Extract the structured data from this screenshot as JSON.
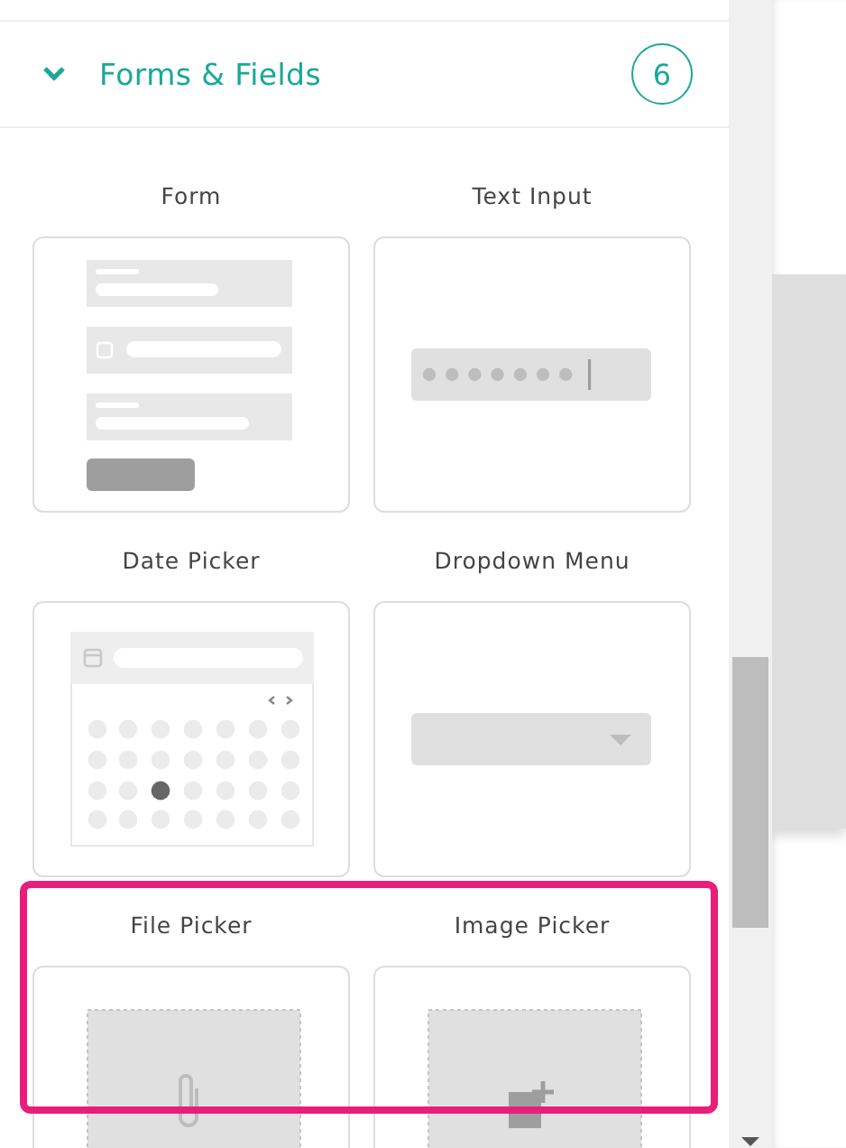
{
  "section": {
    "title": "Forms & Fields",
    "count": "6",
    "expanded": true
  },
  "components": [
    {
      "label": "Form",
      "kind": "form",
      "highlighted": false
    },
    {
      "label": "Text Input",
      "kind": "text_input",
      "highlighted": false
    },
    {
      "label": "Date Picker",
      "kind": "date_picker",
      "highlighted": false
    },
    {
      "label": "Dropdown Menu",
      "kind": "dropdown",
      "highlighted": false
    },
    {
      "label": "File Picker",
      "kind": "file_picker",
      "highlighted": true
    },
    {
      "label": "Image Picker",
      "kind": "image_picker",
      "highlighted": true
    }
  ]
}
